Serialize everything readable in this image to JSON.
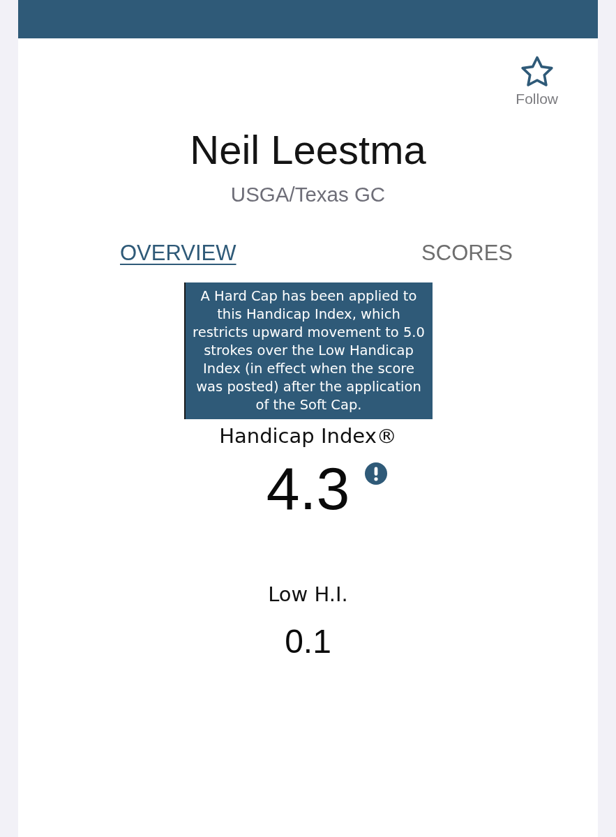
{
  "follow": {
    "label": "Follow",
    "following": false
  },
  "profile": {
    "name": "Neil Leestma",
    "association": "USGA/Texas GC"
  },
  "tabs": [
    {
      "label": "OVERVIEW",
      "selected": true
    },
    {
      "label": "SCORES",
      "selected": false
    }
  ],
  "tooltip": {
    "text": "A Hard Cap has been applied to this Handicap Index, which restricts upward movement to 5.0 strokes over the Low Handicap Index (in effect when the score was posted) after the application of the Soft Cap."
  },
  "handicap_index": {
    "label": "Handicap Index®",
    "value": "4.3",
    "alert": true
  },
  "low_hi": {
    "label": "Low H.I.",
    "value": "0.1"
  }
}
